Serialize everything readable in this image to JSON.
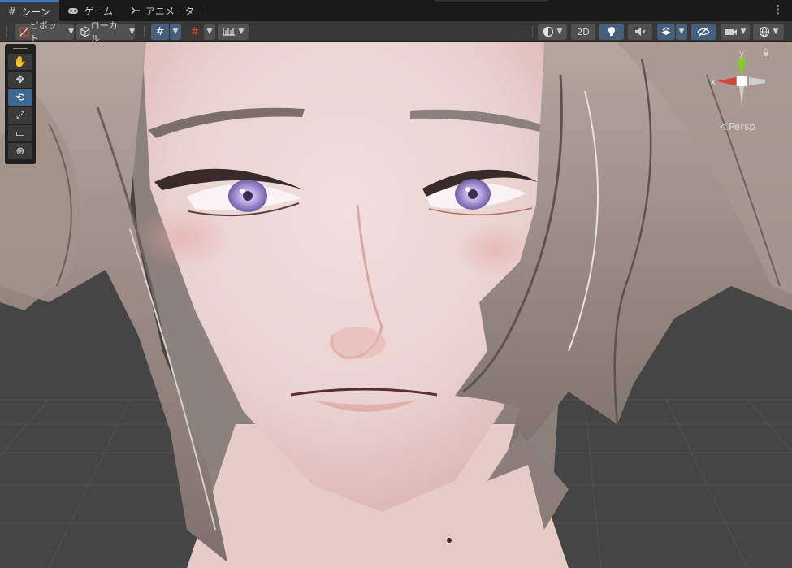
{
  "tabs": [
    {
      "label": "シーン",
      "icon": "scene-grid-icon",
      "active": true
    },
    {
      "label": "ゲーム",
      "icon": "gamepad-icon",
      "active": false
    },
    {
      "label": "アニメーター",
      "icon": "animator-icon",
      "active": false
    }
  ],
  "toolbar": {
    "pivot_label": "ピボット",
    "space_label": "ローカル",
    "shading_label": "",
    "mode_2d_label": "2D"
  },
  "tools": [
    "hand-tool",
    "move-tool",
    "rotate-tool",
    "scale-tool",
    "rect-tool",
    "transform-tool"
  ],
  "active_tool": "rotate-tool",
  "gizmo": {
    "x_label": "x",
    "y_label": "y",
    "projection_label": "＜Persp",
    "x_color": "#d9443a",
    "y_color": "#7ed21d",
    "z_color": "#cfcfcf"
  },
  "colors": {
    "accent": "#3a79bb",
    "active_tool": "#3f6891",
    "viewport_bg": "#454545"
  }
}
